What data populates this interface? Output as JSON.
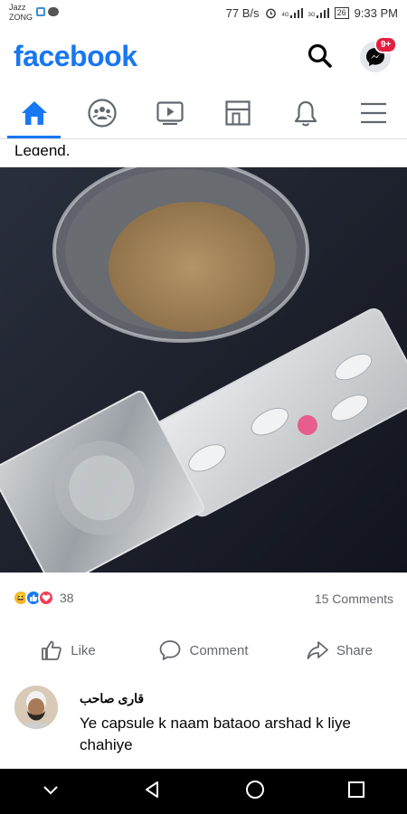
{
  "status_bar": {
    "carrier_line1": "Jazz",
    "carrier_line2": "ZONG",
    "speed": "77 B/s",
    "signal_label_1": "4G",
    "signal_label_2": "3G",
    "battery": "26",
    "time": "9:33 PM"
  },
  "header": {
    "logo": "facebook",
    "messenger_badge": "9+"
  },
  "post": {
    "caption_fragment": "Legend.",
    "reaction_count": "38",
    "comments_count": "15 Comments",
    "actions": {
      "like": "Like",
      "comment": "Comment",
      "share": "Share"
    }
  },
  "comment": {
    "author": "قاری صاحب",
    "text": "Ye capsule  k naam bataoo  arshad  k liye chahiye"
  },
  "colors": {
    "brand": "#1877f2",
    "badge": "#e41e3f",
    "muted": "#65676b"
  },
  "icons": {
    "tabs": [
      "home-icon",
      "groups-icon",
      "watch-icon",
      "marketplace-icon",
      "notifications-icon",
      "menu-icon"
    ],
    "reactions": [
      "haha-icon",
      "like-icon",
      "love-icon"
    ]
  }
}
